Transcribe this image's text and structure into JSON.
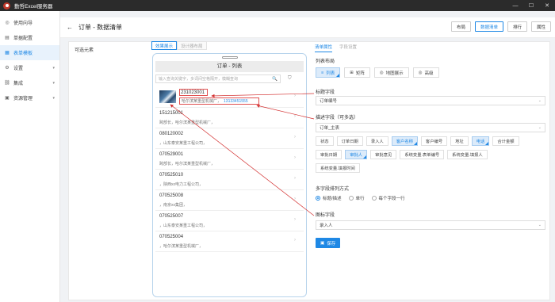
{
  "app": {
    "title": "勤哲Excel服务器"
  },
  "window": {
    "min": "—",
    "max": "☐",
    "close": "✕"
  },
  "sidebar": {
    "items": [
      {
        "label": "使用向导",
        "icon": "guide-icon",
        "glyph": "◎"
      },
      {
        "label": "单据配置",
        "icon": "doc-icon",
        "glyph": "▤"
      },
      {
        "label": "表单模板",
        "icon": "template-icon",
        "glyph": "▦"
      },
      {
        "label": "设置",
        "icon": "gear-icon",
        "glyph": "⚙"
      },
      {
        "label": "集成",
        "icon": "link-icon",
        "glyph": "⛓"
      },
      {
        "label": "资源管理",
        "icon": "resource-icon",
        "glyph": "▣"
      }
    ]
  },
  "header": {
    "back": "←",
    "title": "订单 - 数据清单",
    "buttons": [
      "布局",
      "数据清单",
      "排行",
      "属性"
    ]
  },
  "left": {
    "available": "可选元素"
  },
  "center": {
    "tabs": [
      "效果展示",
      "设计器布局"
    ],
    "phone_title": "订单 - 列表",
    "search_placeholder": "输入查询关键字，多词间空格隔开，模糊查询",
    "search_icon": "🔍",
    "filter_icon": "⛉",
    "rows": [
      {
        "code": "231023001",
        "desc": "哈尔滨某重型机械厂，",
        "phone": "13133451555"
      },
      {
        "code": "151215001",
        "desc": "跨部长，哈尔滨某重型机械厂，"
      },
      {
        "code": "080120002",
        "desc": "，山东泰安某重工程公司，"
      },
      {
        "code": "070529001",
        "desc": "跨部长，哈尔滨某重型机械厂，"
      },
      {
        "code": "070525010",
        "desc": "，陕西xx电力工程公司，"
      },
      {
        "code": "070525008",
        "desc": "，南京xx集团，"
      },
      {
        "code": "070525007",
        "desc": "，山东泰安某重工程公司，"
      },
      {
        "code": "070525004",
        "desc": "，哈尔滨某重型机械厂，"
      }
    ]
  },
  "right": {
    "tabs": [
      "清单属性",
      "字段设置"
    ],
    "layout_label": "列表布局",
    "layout_buttons": [
      {
        "label": "列表",
        "glyph": "≡"
      },
      {
        "label": "矩阵",
        "glyph": "⊞"
      },
      {
        "label": "地图展示",
        "glyph": "◎"
      },
      {
        "label": "高级",
        "glyph": "◎"
      }
    ],
    "title_field_label": "标题字段",
    "title_field_value": "订单编号",
    "desc_field_label": "描述字段（可多选）",
    "desc_field_value": "订单_主表",
    "chips_row1": [
      "状态",
      "订单日期",
      "录入人",
      "客户名称",
      "客户编号",
      "地址",
      "电话",
      "合计金额"
    ],
    "chips_row2": [
      "审批日期",
      "审批人",
      "审批意见",
      "系统变量.表单编号",
      "系统变量.填报人"
    ],
    "chips_row3": [
      "系统变量.填报时间"
    ],
    "multi_label": "多字段排列方式",
    "radios": [
      "标题/描述",
      "单行",
      "每个字段一行"
    ],
    "image_field_label": "图标字段",
    "image_field_value": "录入人",
    "save": "保存",
    "save_icon": "▣"
  }
}
